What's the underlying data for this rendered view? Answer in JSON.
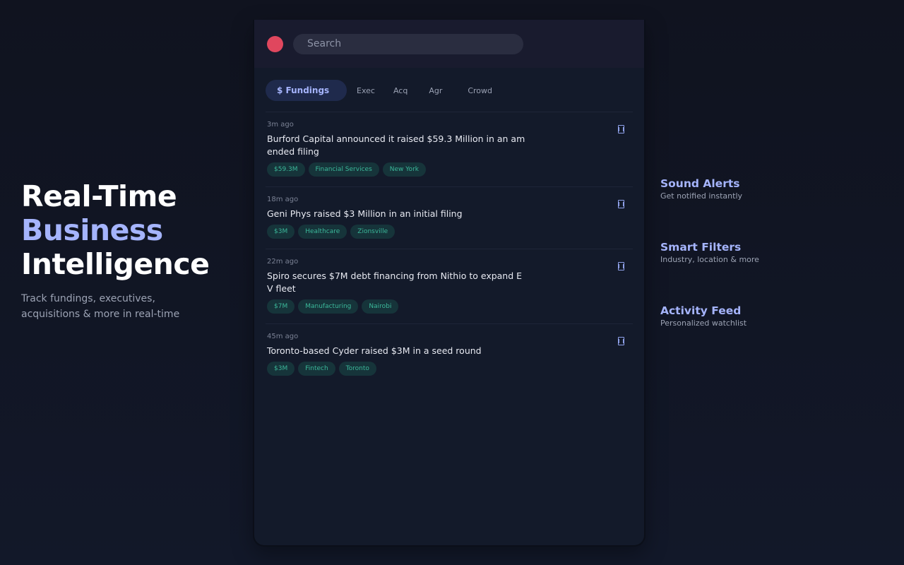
{
  "hero": {
    "line1": "Real-Time",
    "line2": "Business",
    "line3": "Intelligence",
    "subtitle": "Track fundings, executives, acquisitions & more in real-time"
  },
  "app": {
    "search_placeholder": "Search",
    "tabs": [
      {
        "label": "$ Fundings",
        "active": true
      },
      {
        "label": "Exec",
        "active": false
      },
      {
        "label": "Acq",
        "active": false
      },
      {
        "label": "Agr",
        "active": false
      },
      {
        "label": "Crowd",
        "active": false
      }
    ],
    "feed": [
      {
        "time": "3m ago",
        "headline": "Burford Capital announced it raised $59.3 Million in an amended filing",
        "tags": [
          "$59.3M",
          "Financial Services",
          "New York"
        ]
      },
      {
        "time": "18m ago",
        "headline": "Geni Phys raised $3 Million in an initial filing",
        "tags": [
          "$3M",
          "Healthcare",
          "Zionsville"
        ]
      },
      {
        "time": "22m ago",
        "headline": "Spiro secures $7M debt financing from Nithio to expand EV fleet",
        "tags": [
          "$7M",
          "Manufacturing",
          "Nairobi"
        ]
      },
      {
        "time": "45m ago",
        "headline": "Toronto-based Cyder raised $3M in a seed round",
        "tags": [
          "$3M",
          "Fintech",
          "Toronto"
        ]
      }
    ]
  },
  "features": [
    {
      "title": "Sound Alerts",
      "desc": "Get notified instantly"
    },
    {
      "title": "Smart Filters",
      "desc": "Industry, location & more"
    },
    {
      "title": "Activity Feed",
      "desc": "Personalized watchlist"
    }
  ],
  "colors": {
    "accent": "#a5b4fc",
    "record": "#e0475e",
    "tag_text": "#3bb89a",
    "tag_bg": "#16343a"
  },
  "icons": {
    "record": "record-dot-icon",
    "bookmark": "bookmark-icon"
  }
}
